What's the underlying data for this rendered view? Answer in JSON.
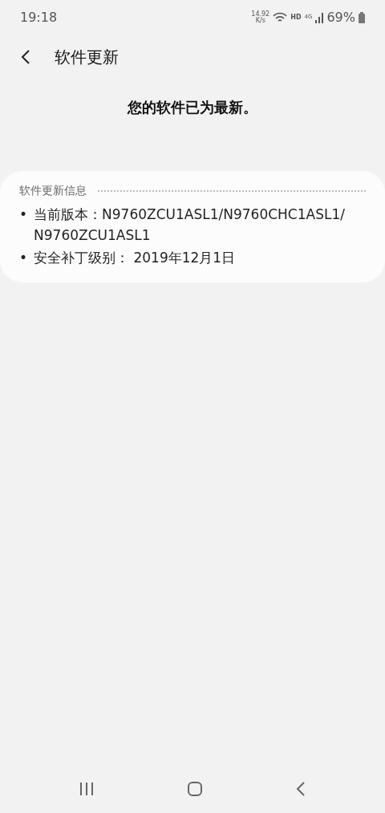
{
  "status_bar": {
    "time": "19:18",
    "net_speed_value": "14.92",
    "net_speed_unit": "K/s",
    "hd": "HD",
    "network": "4G",
    "battery": "69%"
  },
  "header": {
    "title": "软件更新"
  },
  "message": "您的软件已为最新。",
  "info_card": {
    "title": "软件更新信息",
    "items": [
      {
        "bullet": "•",
        "text": "当前版本：N9760ZCU1ASL1/N9760CHC1ASL1/ N9760ZCU1ASL1"
      },
      {
        "bullet": "•",
        "text": "安全补丁级别： 2019年12月1日"
      }
    ]
  }
}
